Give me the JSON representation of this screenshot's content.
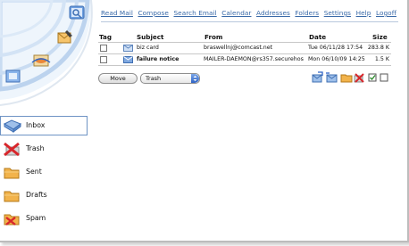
{
  "nav": {
    "items": [
      "Read Mail",
      "Compose",
      "Search Email",
      "Calendar",
      "Addresses",
      "Folders",
      "Settings",
      "Help",
      "Logoff"
    ]
  },
  "mail_table": {
    "columns": {
      "tag": "Tag",
      "subject": "Subject",
      "from": "From",
      "date": "Date",
      "size": "Size"
    },
    "rows": [
      {
        "subject": "biz card",
        "from": "braswellnj@comcast.net",
        "date": "Tue 06/11/28 17:54",
        "size": "283.8 K",
        "unread": false
      },
      {
        "subject": "failure notice",
        "from": "MAILER-DAEMON@rs357.securehost...",
        "date": "Mon 06/10/09 14:25",
        "size": "1.5 K",
        "unread": true
      }
    ]
  },
  "actions": {
    "move_label": "Move",
    "target_folder": "Trash"
  },
  "folders": {
    "items": [
      {
        "label": "Inbox",
        "icon": "inbox-icon",
        "active": true
      },
      {
        "label": "Trash",
        "icon": "trash-icon",
        "active": false
      },
      {
        "label": "Sent",
        "icon": "sent-folder-icon",
        "active": false
      },
      {
        "label": "Drafts",
        "icon": "drafts-folder-icon",
        "active": false
      },
      {
        "label": "Spam",
        "icon": "spam-folder-icon",
        "active": false
      }
    ]
  },
  "colors": {
    "link": "#3a6aa8",
    "swirl": "#b9d3ee",
    "folder": "#f2b34b",
    "active_border": "#6e93c4"
  }
}
